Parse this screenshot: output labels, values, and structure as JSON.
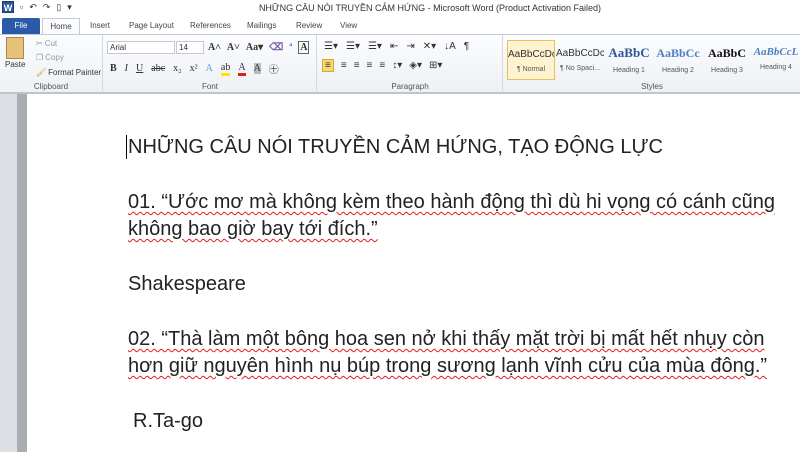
{
  "window": {
    "title": "NHỮNG CÂU NÓI TRUYỀN CẢM HỨNG  -  Microsoft Word (Product Activation Failed)"
  },
  "tabs": [
    "File",
    "Home",
    "Insert",
    "Page Layout",
    "References",
    "Mailings",
    "Review",
    "View"
  ],
  "clipboard": {
    "paste": "Paste",
    "cut": "Cut",
    "copy": "Copy",
    "format_painter": "Format Painter",
    "label": "Clipboard"
  },
  "font": {
    "name": "Arial",
    "size": "14",
    "label": "Font"
  },
  "paragraph": {
    "label": "Paragraph"
  },
  "styles": {
    "label": "Styles",
    "items": [
      {
        "preview": "AaBbCcDc",
        "name": "¶ Normal"
      },
      {
        "preview": "AaBbCcDc",
        "name": "¶ No Spaci..."
      },
      {
        "preview": "AaBbC",
        "name": "Heading 1"
      },
      {
        "preview": "AaBbCc",
        "name": "Heading 2"
      },
      {
        "preview": "AaBbC",
        "name": "Heading 3"
      },
      {
        "preview": "AaBbCcL",
        "name": "Heading 4"
      }
    ]
  },
  "document": {
    "heading": "NHỮNG CÂU NÓI TRUYỀN CẢM HỨNG, TẠO ĐỘNG LỰC",
    "q1_line1": "01. “Ước mơ mà không kèm theo hành động thì dù hi vọng có cánh cũng",
    "q1_line2": "không bao giờ bay tới đích.”",
    "author1": "Shakespeare",
    "q2_line1": "02. “Thà làm một bông hoa sen nở khi thấy mặt trời bị mất hết nhụy còn",
    "q2_line2": "hơn giữ nguyên hình nụ búp trong sương lạnh vĩnh cửu của mùa đông.”",
    "author2": "R.Ta-go"
  }
}
